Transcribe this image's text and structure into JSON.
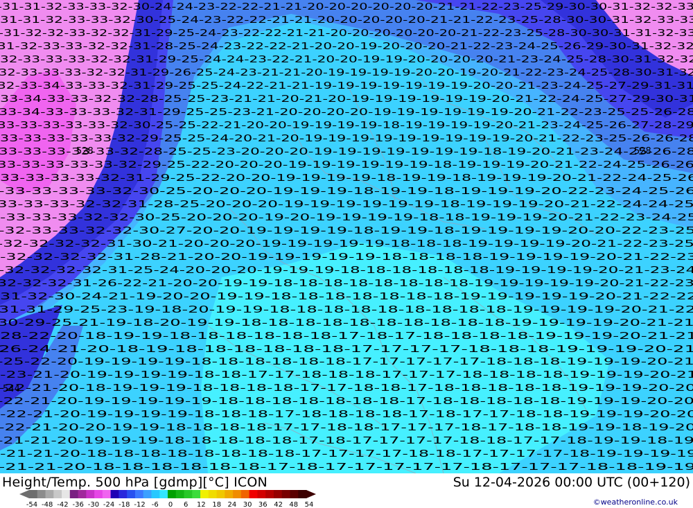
{
  "title": "Height/Temp. 500 hPa [gdmp][°C] ICON",
  "timestamp": "Su 12-04-2026 00:00 UTC (00+120)",
  "credit": "©weatheronline.co.uk",
  "legend": {
    "ticks": [
      "-54",
      "-48",
      "-42",
      "-36",
      "-30",
      "-24",
      "-18",
      "-12",
      "-6",
      "0",
      "6",
      "12",
      "18",
      "24",
      "30",
      "36",
      "42",
      "48",
      "54"
    ],
    "colors": [
      "#6e6e6e",
      "#8c8c8c",
      "#aaaaaa",
      "#c8c8c8",
      "#e6e6e6",
      "#7a1f82",
      "#a0289c",
      "#c832c8",
      "#e646e6",
      "#f064f0",
      "#1e00b4",
      "#2828dc",
      "#2850f0",
      "#3c78ff",
      "#3ca0ff",
      "#28c8ff",
      "#32e6ff",
      "#00a000",
      "#14b414",
      "#28c828",
      "#3cdc3c",
      "#f0f000",
      "#f0dc00",
      "#f0c800",
      "#f0aa00",
      "#f08c00",
      "#f06400",
      "#f00000",
      "#d20000",
      "#b40000",
      "#960000",
      "#780000",
      "#5a0000",
      "#3c0000"
    ]
  },
  "colors": {
    "magenta": "#f08cf0",
    "magenta_bright": "#f064f0",
    "dark_blue": "#3232dc",
    "blue": "#4646f0",
    "mid_blue": "#4682f0",
    "light_blue": "#46b4ff",
    "cyan_blue": "#3cd2ff",
    "cyan": "#46f0ff",
    "border": "#a0a0b4"
  },
  "map_labels": {
    "rows": [
      "-31-31-32-33-33-32-30-24-24-23-22-22-21-21-20-20-20-20-20-20-21-21-22-23-25-29-30-30-31-32-32-33",
      "31-31-32-33-33-32-30-25-24-23-22-22-21-21-20-20-20-20-20-21-21-22-23-25-28-30-30-31-32-33-33",
      "-31-32-32-33-32-32-31-29-25-24-23-22-22-21-21-20-20-20-20-20-20-21-22-23-25-28-30-30-31-31-32-33",
      "31-32-33-33-32-32-31-28-25-24-23-22-22-21-20-20-19-20-20-20-21-22-23-24-25-26-29-30-31-32-32",
      "32-33-33-33-32-32-31-29-25-24-24-23-22-21-20-20-19-19-20-20-20-20-21-23-24-25-28-30-31-32-32",
      "32-33-33-33-32-32-31-29-26-25-24-23-21-21-20-19-19-19-19-20-20-19-20-21-22-23-24-25-28-30-31-32",
      "32-33-34-33-33-32-31-29-25-25-24-22-21-21-19-19-19-19-19-19-19-20-20-21-23-24-25-27-29-31-31",
      "33-34-33-33-32-32-28-25-25-23-21-21-20-21-20-19-19-19-19-19-19-20-21-22-24-25-27-29-30-31",
      "33-34-33-33-33-32-31-29-25-25-23-21-20-20-20-20-19-19-19-19-19-19-20-21-22-23-25-25-26-28",
      "33-33-33-33-33-32-30-25-25-22-21-20-20-19-19-19-19-18-19-19-19-19-20-21-23-24-25-26-27-28-29",
      "33-33-33-33-33-32-29-25-25-24-20-21-20-19-19-19-19-19-19-19-19-19-20-21-22-23-25-26-26-28",
      "33-33-33-33-33-32-28-25-25-23-20-20-20-19-19-19-19-19-19-19-18-19-20-21-23-24-25-26-28",
      "33-33-33-33-33-32-29-25-22-20-20-20-19-19-19-19-19-19-18-19-19-19-20-21-22-24-25-26-26",
      "33-33-33-33-32-31-29-25-22-20-20-19-19-19-19-18-19-19-18-19-19-19-20-21-22-24-25-26",
      "-33-33-33-33-32-30-25-20-20-20-19-19-19-18-19-19-18-19-19-19-20-22-23-24-25-26",
      "33-33-33-32-32-31-28-25-20-20-20-19-19-19-19-19-19-18-19-19-19-20-21-22-24-24-25",
      "-33-33-33-32-32-30-25-20-20-20-19-20-19-19-19-19-18-18-19-19-19-20-21-22-23-24-25",
      "-32-33-33-32-32-30-27-20-20-19-19-19-19-18-19-19-18-19-19-19-19-20-20-22-23-25",
      "-32-32-32-32-31-30-21-20-20-20-19-19-19-19-19-18-18-18-19-19-19-19-20-21-22-23-25",
      "-32-32-32-32-31-28-21-20-20-19-19-19-19-19-18-18-18-18-19-19-19-19-20-21-22-23",
      "-32-32-32-32-31-25-24-20-20-20-19-19-19-18-18-18-18-18-18-19-19-19-19-20-21-23-24",
      "32-32-32-31-26-22-21-20-20-19-19-18-18-18-18-18-18-18-18-19-19-19-19-19-20-21-22-23",
      "31-32-30-24-21-19-20-20-19-19-18-18-18-18-18-18-18-19-19-19-19-19-20-21-22-22",
      "31-31-29-25-23-19-18-20-19-19-18-18-18-18-18-18-18-18-18-19-19-19-19-20-21-22",
      "30-29-25-21-19-18-20-19-19-18-18-18-18-18-18-18-18-18-18-19-19-19-19-20-21-21",
      "28-22-20-18-19-19-18-18-18-18-18-18-17-18-17-18-18-18-18-19-19-19-20-21-21",
      "26-24-21-20-18-19-18-18-18-18-18-18-17-17-17-17-18-18-18-19-19-19-20-21",
      "-25-22-20-19-19-19-19-18-18-18-18-18-18-17-17-17-17-17-18-18-18-19-19-19-20-21",
      "-23-21-20-19-19-19-19-18-18-17-17-18-18-18-17-17-17-18-18-18-18-19-19-19-20-21",
      "-22-21-20-18-19-19-19-18-18-18-18-17-17-18-18-17-18-18-18-18-18-19-19-19-20-20",
      "-22-21-20-19-19-19-19-19-18-18-18-18-18-18-18-17-18-18-18-18-18-19-19-19-20-20",
      "-22-21-20-19-19-19-19-18-18-18-17-18-18-18-18-17-18-17-17-18-18-19-19-19-20-20",
      "-22-21-20-20-19-19-18-18-18-18-17-17-18-18-17-17-17-18-17-18-18-19-19-18-19-20",
      "-21-21-20-19-19-19-18-18-18-18-18-17-18-17-17-17-17-18-18-17-17-18-19-19-18-19",
      "-21-21-20-18-18-18-18-18-18-18-18-17-17-17-17-18-18-17-17-17-17-18-19-19-19-19",
      "-21-21-20-18-18-18-18-18-18-17-18-17-17-17-17-17-18-17-17-17-18-18-19-19"
    ],
    "extra": [
      "528",
      "528",
      "544"
    ]
  }
}
